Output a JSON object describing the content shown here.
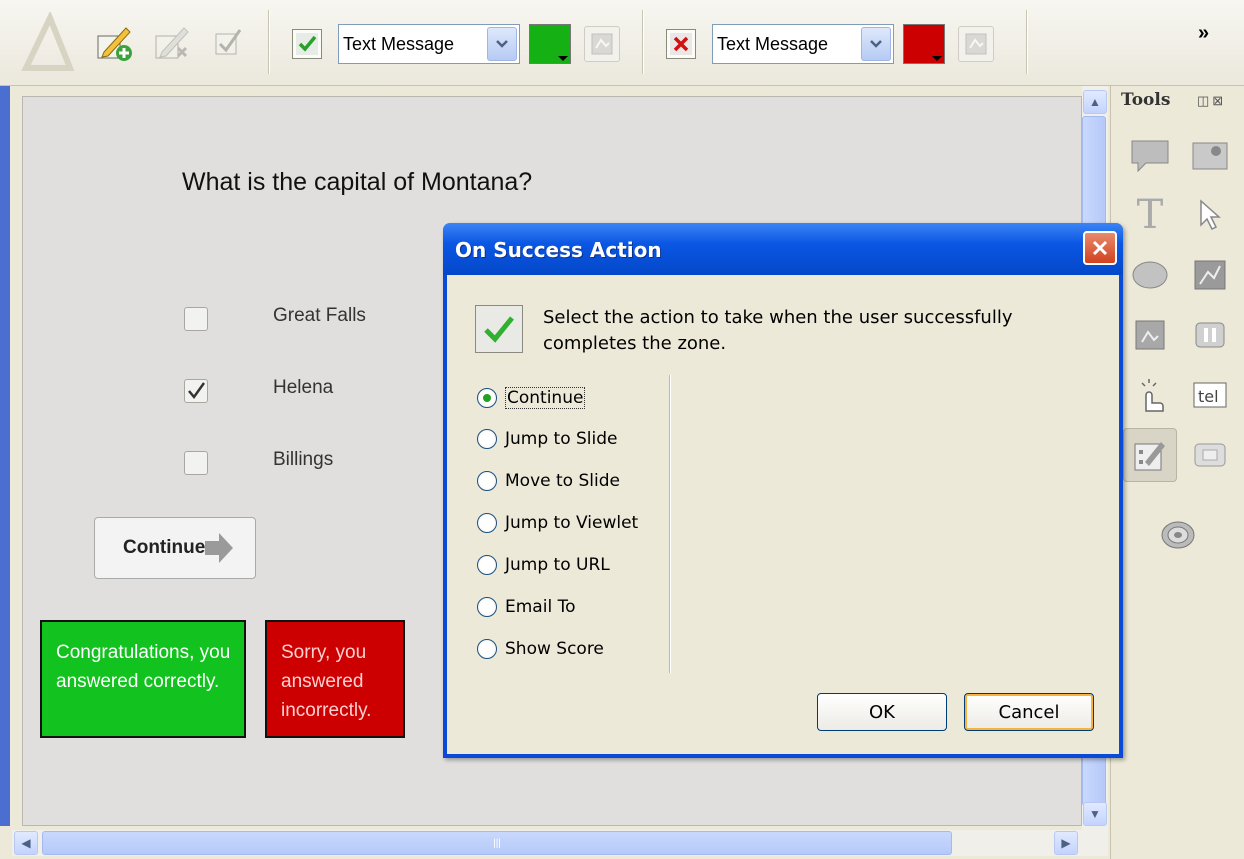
{
  "toolbar": {
    "success_action": "Text Message",
    "failure_action": "Text Message",
    "success_color": "#14b014",
    "failure_color": "#cc0000",
    "more_label": "»",
    "icons": [
      "logo-icon",
      "add-zone-icon",
      "remove-zone-icon",
      "validate-icon",
      "success-check-icon",
      "success-color-button",
      "success-image-icon",
      "failure-x-icon",
      "failure-color-button",
      "failure-image-icon"
    ]
  },
  "slide": {
    "question": "What is the capital of Montana?",
    "options": [
      {
        "label": "Great Falls",
        "checked": false
      },
      {
        "label": "Helena",
        "checked": true
      },
      {
        "label": "Billings",
        "checked": false
      }
    ],
    "continue_label": "Continue",
    "success_message": "Congratulations, you answered correctly.",
    "failure_message": "Sorry, you answered incorrectly."
  },
  "tools": {
    "title": "Tools",
    "items": [
      "callout-icon",
      "image-icon",
      "text-icon",
      "pointer-icon",
      "highlight-icon",
      "flash-icon",
      "image-zone-icon",
      "pause-icon",
      "hotspot-icon",
      "text-entry-icon",
      "quiz-icon",
      "button-icon",
      "spiral-icon"
    ]
  },
  "dialog": {
    "title": "On Success Action",
    "message": "Select the action to take when the user successfully completes the zone.",
    "options": [
      "Continue",
      "Jump to Slide",
      "Move to Slide",
      "Jump to Viewlet",
      "Jump to URL",
      "Email To",
      "Show Score"
    ],
    "selected": "Continue",
    "ok_label": "OK",
    "cancel_label": "Cancel"
  }
}
